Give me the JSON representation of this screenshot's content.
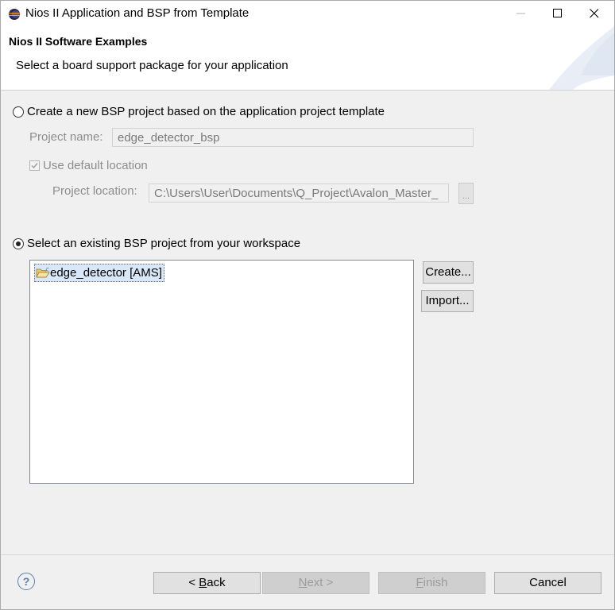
{
  "window": {
    "title": "Nios II Application and BSP from Template"
  },
  "banner": {
    "title": "Nios II Software Examples",
    "description": "Select a board support package for your application"
  },
  "new_bsp": {
    "radio_label": "Create a new BSP project based on the application project template",
    "selected": false,
    "project_name_label": "Project name:",
    "project_name_value": "edge_detector_bsp",
    "default_location_label": "Use default location",
    "default_location_checked": true,
    "project_location_label": "Project location:",
    "project_location_value": "C:\\Users\\User\\Documents\\Q_Project\\Avalon_Master_",
    "browse_label": "..."
  },
  "existing_bsp": {
    "radio_label": "Select an existing BSP project from your workspace",
    "selected": true,
    "items": [
      {
        "label": "edge_detector [AMS]",
        "selected": true
      }
    ],
    "create_button": "Create...",
    "import_button": "Import..."
  },
  "footer": {
    "help_icon": "?",
    "back_prefix": "< ",
    "back_mnemonic": "B",
    "back_rest": "ack",
    "next_mnemonic": "N",
    "next_rest": "ext >",
    "finish_mnemonic": "F",
    "finish_rest": "inish",
    "cancel": "Cancel"
  }
}
